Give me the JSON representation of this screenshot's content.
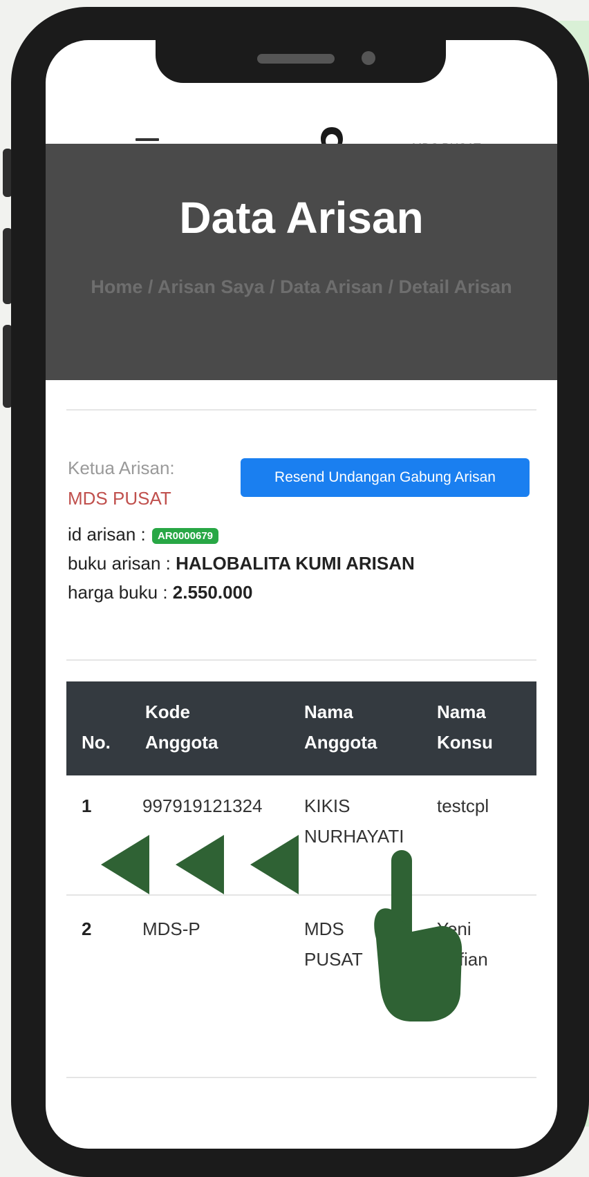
{
  "header": {
    "back_glyph": "←",
    "user_name": "MDS PUSAT",
    "caret_glyph": "▼"
  },
  "hero": {
    "title": "Data Arisan",
    "breadcrumb": "Home / Arisan Saya / Data Arisan / Detail Arisan"
  },
  "info": {
    "ketua_label": "Ketua Arisan:",
    "ketua_value": "MDS PUSAT",
    "resend_button": "Resend Undangan Gabung Arisan",
    "id_label": "id arisan : ",
    "id_value": "AR0000679",
    "buku_label": "buku arisan : ",
    "buku_value": "HALOBALITA KUMI ARISAN",
    "harga_label": "harga buku : ",
    "harga_value": "2.550.000"
  },
  "table": {
    "headers": [
      "No.",
      "Kode Anggota",
      "Nama Anggota",
      "Nama Konsu"
    ],
    "header_lines": {
      "kode": [
        "Kode",
        "Anggota"
      ],
      "nama": [
        "Nama",
        "Anggota"
      ],
      "konsu": [
        "Nama",
        "Konsu"
      ]
    },
    "rows": [
      {
        "no": "1",
        "kode": "997919121324",
        "nama_l1": "KIKIS",
        "nama_l2": "NURHAYATI",
        "konsu_l1": "testcpl",
        "konsu_l2": ""
      },
      {
        "no": "2",
        "kode": "MDS-P",
        "nama_l1": "MDS",
        "nama_l2": "PUSAT",
        "konsu_l1": "Yeni",
        "konsu_l2": "Sofian"
      }
    ]
  },
  "colors": {
    "hero_bg": "#4a4a4a",
    "button_blue": "#1a7ff0",
    "badge_green": "#28a745",
    "ketua_red": "#c0504d",
    "table_head": "#343a40",
    "swipe_hint_green": "#2f6234"
  },
  "icons": {
    "avatar": "hijab-user-icon",
    "menu": "hamburger-icon",
    "swipe": "swipe-left-hand-icon"
  }
}
